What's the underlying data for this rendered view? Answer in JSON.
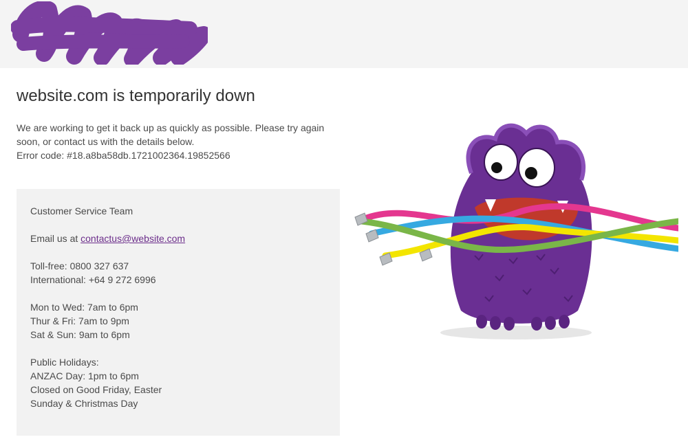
{
  "header": {
    "logo_icon": "redacted-purple-scribble-logo",
    "logo_color": "#7b3fa0",
    "background": "#f4f4f4"
  },
  "main": {
    "title": "website.com is temporarily down",
    "intro": "We are working to get it back up as quickly as possible. Please try again soon, or contact us with the details below.",
    "error_code": "Error code: #18.a8ba58db.1721002364.19852566"
  },
  "contact": {
    "team": "Customer Service Team",
    "email_prefix": "Email us at ",
    "email": "contactus@website.com",
    "tollfree": "Toll-free: 0800 327 637",
    "international": "International: +64 9 272 6996",
    "hours": [
      "Mon to Wed: 7am to 6pm",
      "Thur & Fri: 7am to 9pm",
      "Sat & Sun: 9am to 6pm"
    ],
    "holidays_heading": "Public Holidays:",
    "holidays": [
      "ANZAC Day: 1pm to 6pm",
      "Closed on Good Friday, Easter",
      "Sunday & Christmas Day"
    ]
  },
  "illustration": {
    "icon": "purple-monster-chewing-cables-icon",
    "body_color": "#6a2f93",
    "cable_colors": [
      "#e4378f",
      "#36a9e1",
      "#f3e500",
      "#7ab648"
    ]
  }
}
